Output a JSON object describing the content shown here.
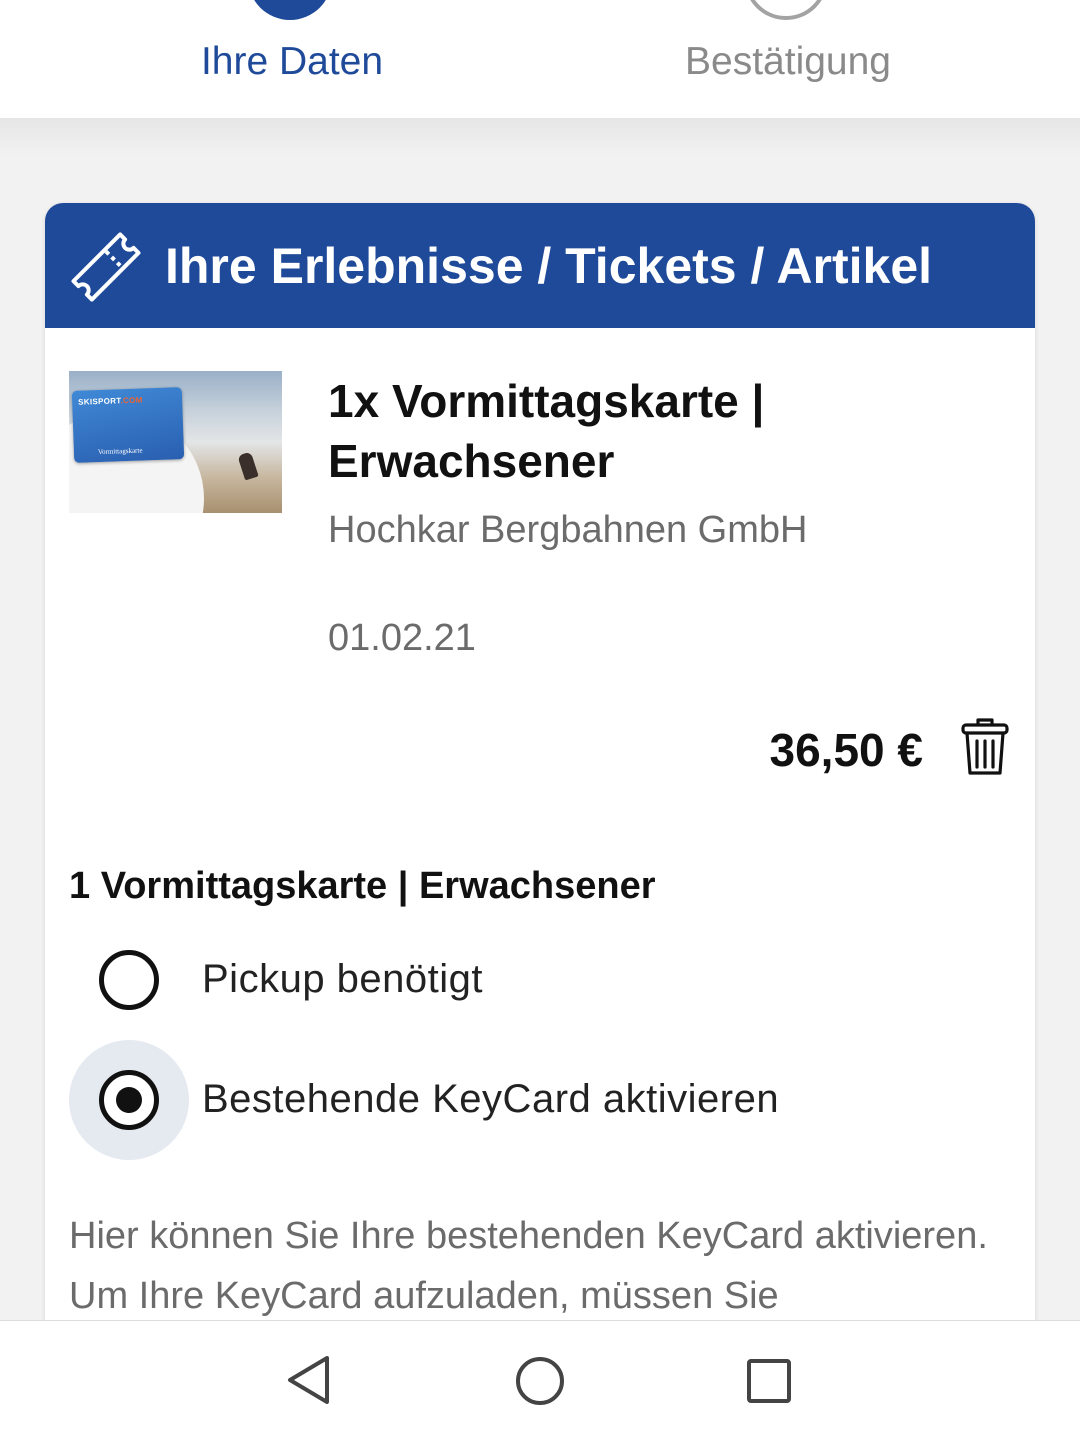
{
  "stepper": {
    "steps": [
      {
        "label": "Ihre Daten",
        "state": "active"
      },
      {
        "label": "Bestätigung",
        "state": "inactive"
      }
    ]
  },
  "cart": {
    "header_title": "Ihre Erlebnisse / Tickets / Artikel",
    "header_icon": "ticket-icon",
    "item": {
      "thumbnail": {
        "logo_main": "SKISPORT",
        "logo_accent": ".COM",
        "card_name": "Vormittagskarte"
      },
      "title": "1x Vormittagskarte | Erwachsener",
      "vendor": "Hochkar Bergbahnen GmbH",
      "date": "01.02.21",
      "price": "36,50 €",
      "delete_icon": "trash-icon"
    },
    "section_heading": "1 Vormittagskarte | Erwachsener",
    "options": [
      {
        "label": "Pickup benötigt",
        "selected": false
      },
      {
        "label": "Bestehende KeyCard aktivieren",
        "selected": true
      }
    ],
    "info_text": "Hier können Sie Ihre bestehenden KeyCard aktivieren. Um Ihre KeyCard aufzuladen, müssen Sie"
  },
  "navbar": {
    "icons": [
      "back-icon",
      "home-icon",
      "recent-apps-icon"
    ]
  },
  "colors": {
    "brand_blue": "#1f4a99",
    "inactive_gray": "#8a8a8a",
    "selection_halo": "#e5e9f0"
  }
}
